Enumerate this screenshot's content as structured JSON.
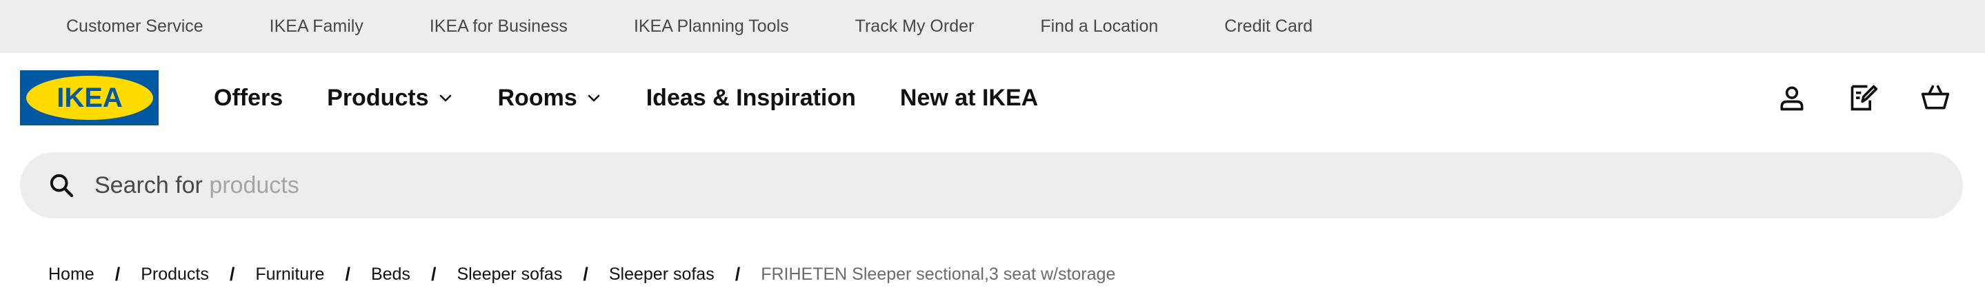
{
  "topbar": {
    "links": [
      "Customer Service",
      "IKEA Family",
      "IKEA for Business",
      "IKEA Planning Tools",
      "Track My Order",
      "Find a Location",
      "Credit Card"
    ]
  },
  "header": {
    "logo_text": "IKEA",
    "nav": [
      {
        "label": "Offers"
      },
      {
        "label": "Products"
      },
      {
        "label": "Rooms"
      },
      {
        "label": "Ideas & Inspiration"
      },
      {
        "label": "New at IKEA"
      }
    ],
    "icons": [
      "user-icon",
      "shopping-list-icon",
      "cart-icon"
    ]
  },
  "search": {
    "prefix": "Search for",
    "placeholder": "products"
  },
  "breadcrumb": {
    "items": [
      "Home",
      "Products",
      "Furniture",
      "Beds",
      "Sleeper sofas",
      "Sleeper sofas",
      "FRIHETEN Sleeper sectional,3 seat w/storage"
    ],
    "separator": "/"
  },
  "colors": {
    "brand_blue": "#0058a3",
    "brand_yellow": "#ffdb00",
    "topbar_bg": "#ededed",
    "search_bg": "#ededed"
  }
}
